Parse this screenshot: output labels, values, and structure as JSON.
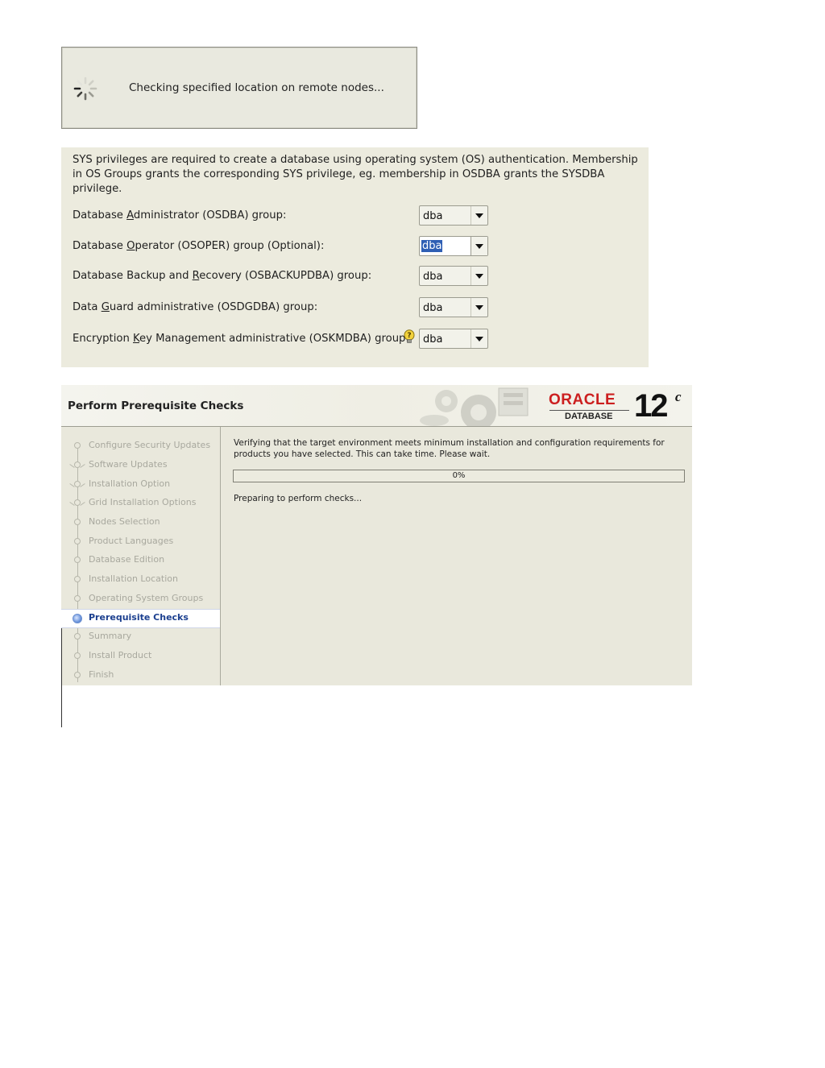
{
  "progress_dialog": {
    "message": "Checking specified location on remote nodes..."
  },
  "os_groups": {
    "intro": "SYS privileges are required to create a database using operating system (OS) authentication. Membership in OS Groups grants the corresponding SYS privilege, eg. membership in OSDBA grants the SYSDBA privilege.",
    "rows": [
      {
        "label_pre": "Database ",
        "mnemonic": "A",
        "label_post": "dministrator (OSDBA) group:",
        "value": "dba"
      },
      {
        "label_pre": "Database ",
        "mnemonic": "O",
        "label_post": "perator (OSOPER) group (Optional):",
        "value": "dba"
      },
      {
        "label_pre": "Database Backup and ",
        "mnemonic": "R",
        "label_post": "ecovery (OSBACKUPDBA) group:",
        "value": "dba"
      },
      {
        "label_pre": "Data ",
        "mnemonic": "G",
        "label_post": "uard administrative (OSDGDBA) group:",
        "value": "dba"
      },
      {
        "label_pre": "Encryption ",
        "mnemonic": "K",
        "label_post": "ey Management administrative (OSKMDBA) group:",
        "value": "dba"
      }
    ]
  },
  "installer": {
    "title": "Perform Prerequisite Checks",
    "brand": {
      "name": "ORACLE",
      "product": "DATABASE",
      "version": "12",
      "version_suffix": "c"
    },
    "steps": [
      "Configure Security Updates",
      "Software Updates",
      "Installation Option",
      "Grid Installation Options",
      "Nodes Selection",
      "Product Languages",
      "Database Edition",
      "Installation Location",
      "Operating System Groups",
      "Prerequisite Checks",
      "Summary",
      "Install Product",
      "Finish"
    ],
    "active_step": "Prerequisite Checks",
    "verify_text": "Verifying that the target environment meets minimum installation and configuration requirements for products you have selected. This can take time. Please wait.",
    "progress_percent": 0,
    "progress_label": "0%",
    "status_text": "Preparing to perform checks..."
  },
  "colors": {
    "panel_bg": "#ecebde",
    "oracle_red": "#cc1f1f",
    "selection_blue": "#2f5fb4",
    "active_step_text": "#1b3f8f"
  }
}
